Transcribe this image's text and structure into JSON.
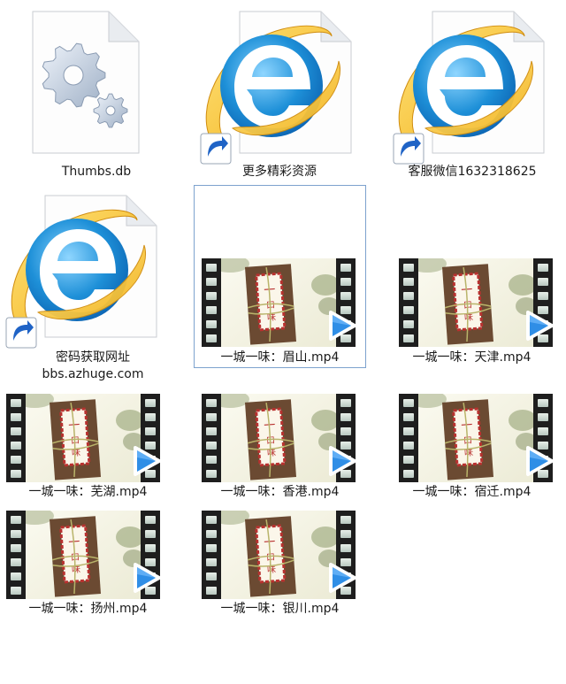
{
  "files": [
    {
      "id": "thumbs",
      "type": "system-file",
      "icon": "gear-icon",
      "label": [
        "Thumbs.db"
      ]
    },
    {
      "id": "more",
      "type": "url-shortcut",
      "icon": "ie-shortcut-icon",
      "label": [
        "更多精彩资源"
      ]
    },
    {
      "id": "wechat",
      "type": "url-shortcut",
      "icon": "ie-shortcut-icon",
      "label": [
        "客服微信1632318625"
      ]
    },
    {
      "id": "pwd",
      "type": "url-shortcut",
      "icon": "ie-shortcut-icon",
      "label": [
        "密码获取网址",
        "bbs.azhuge.com"
      ]
    },
    {
      "id": "meishan",
      "type": "video",
      "icon": "video-thumbnail",
      "label": [
        "一城一味：眉山.mp4"
      ],
      "selected": true
    },
    {
      "id": "tianjin",
      "type": "video",
      "icon": "video-thumbnail",
      "label": [
        "一城一味：天津.mp4"
      ]
    },
    {
      "id": "wuhu",
      "type": "video",
      "icon": "video-thumbnail",
      "label": [
        "一城一味：芜湖.mp4"
      ]
    },
    {
      "id": "hongkong",
      "type": "video",
      "icon": "video-thumbnail",
      "label": [
        "一城一味：香港.mp4"
      ]
    },
    {
      "id": "suqian",
      "type": "video",
      "icon": "video-thumbnail",
      "label": [
        "一城一味：宿迁.mp4"
      ]
    },
    {
      "id": "yangzhou",
      "type": "video",
      "icon": "video-thumbnail",
      "label": [
        "一城一味：扬州.mp4"
      ]
    },
    {
      "id": "yinchuan",
      "type": "video",
      "icon": "video-thumbnail",
      "label": [
        "一城一味：银川.mp4"
      ]
    }
  ],
  "thumbnail_title": "一城一味",
  "colors": {
    "selection_border": "#7da2ce",
    "ie_blue": "#1e90d8",
    "ie_ring": "#f2b21a",
    "card_brown": "#6b4a32",
    "card_red": "#b8312f",
    "play_blue": "#2f8ee6"
  }
}
